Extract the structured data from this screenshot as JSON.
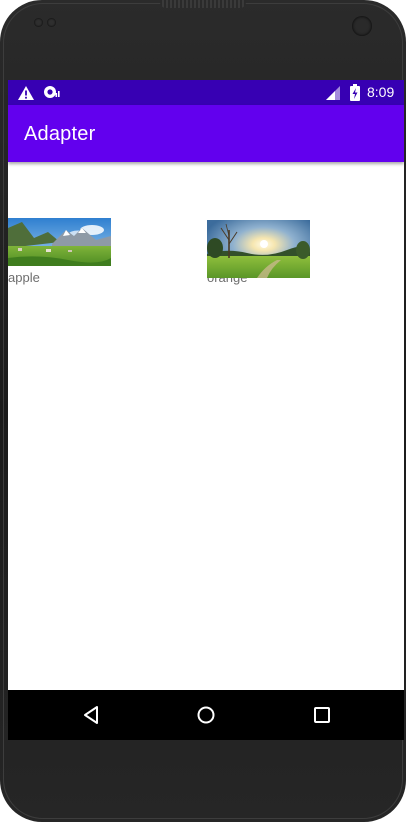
{
  "status_bar": {
    "time": "8:09",
    "icons": [
      "warning-icon",
      "sync-icon",
      "cell-signal-icon",
      "battery-charging-icon"
    ],
    "background": "#3700b3"
  },
  "app_bar": {
    "title": "Adapter",
    "background": "#6200ee"
  },
  "grid": {
    "items": [
      {
        "label": "apple",
        "image": "mountain-meadow-photo"
      },
      {
        "label": "orange",
        "image": "sunset-field-photo"
      }
    ]
  },
  "nav_bar": {
    "buttons": [
      "back-icon",
      "home-icon",
      "recents-icon"
    ]
  }
}
